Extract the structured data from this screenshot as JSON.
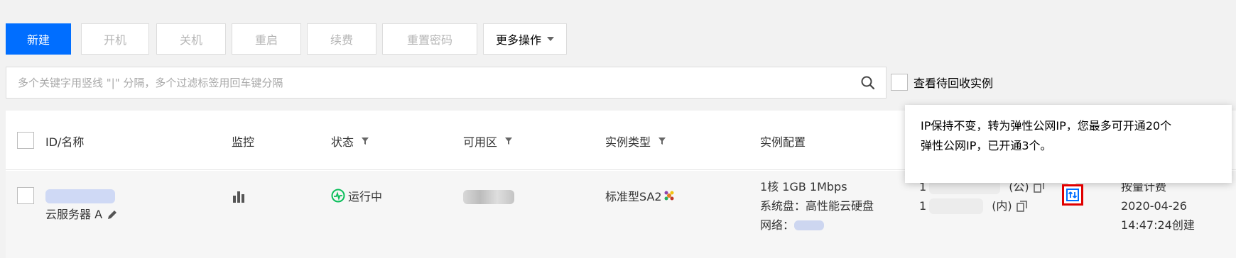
{
  "toolbar": {
    "buttons": [
      "新建",
      "开机",
      "关机",
      "重启",
      "续费",
      "重置密码",
      "更多操作"
    ]
  },
  "search": {
    "placeholder": "多个关键字用竖线 \"|\" 分隔，多个过滤标签用回车键分隔"
  },
  "recycle_checkbox_label": "查看待回收实例",
  "table": {
    "headers": {
      "id_name": "ID/名称",
      "monitor": "监控",
      "status": "状态",
      "zone": "可用区",
      "instance_type": "实例类型",
      "config": "实例配置"
    },
    "row": {
      "name": "云服务器 A",
      "status": "运行中",
      "instance_type": "标准型SA2",
      "config_line1": "1核 1GB 1Mbps",
      "config_line2": "系统盘：高性能云硬盘",
      "network_label": "网络：",
      "ip_public_prefix": "1",
      "ip_public_suffix": "(公)",
      "ip_private_prefix": "1",
      "ip_private_suffix": "(内)",
      "billing": "按量计费",
      "created_date": "2020-04-26",
      "created_time": "14:47:24创建"
    }
  },
  "tooltip": {
    "line1": "IP保持不变，转为弹性公网IP，您最多可开通20个",
    "line2": "弹性公网IP，已开通3个。"
  },
  "colors": {
    "primary": "#006eff",
    "running": "#0abf5b",
    "highlight": "#e00000"
  },
  "icons": [
    "search-icon",
    "bar-chart-icon",
    "running-status-icon",
    "edit-icon",
    "copy-icon",
    "convert-ip-icon",
    "filter-icon",
    "chevron-down-icon"
  ]
}
